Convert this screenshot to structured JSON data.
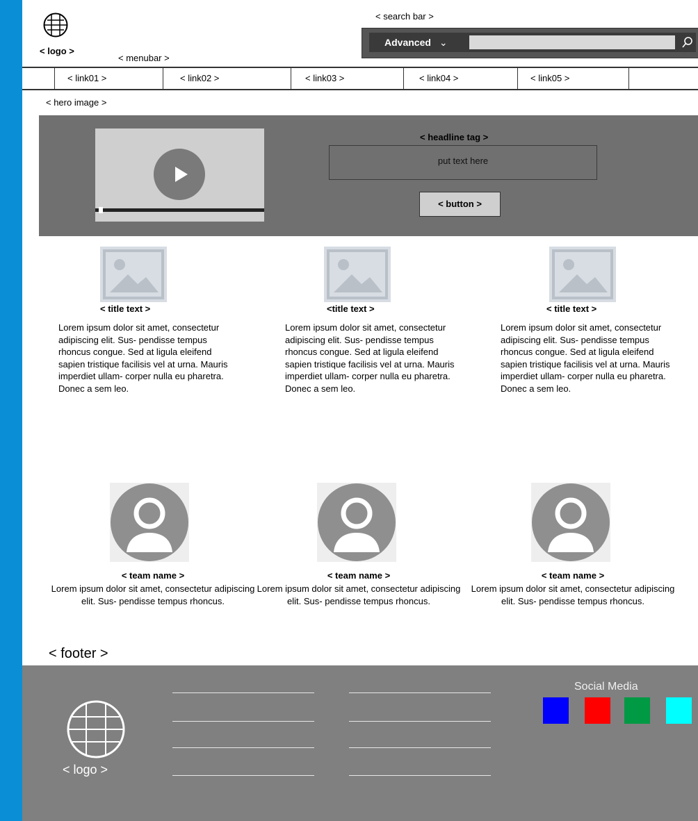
{
  "header": {
    "logo_label": "< logo >",
    "menubar_label": "< menubar >",
    "search_bar_label": "< search bar >",
    "search": {
      "filter_label": "Advanced",
      "placeholder": "",
      "filter_icon": "chevron-down-icon",
      "submit_icon": "search-icon"
    }
  },
  "nav": {
    "links": [
      "< link01 >",
      "< link02 >",
      "< link03 >",
      "< link04 >",
      "< link05 >"
    ]
  },
  "hero": {
    "label": "< hero image >",
    "video": {
      "play_icon": "play-icon",
      "progress_fraction": 0.02
    },
    "headline_tag": "< headline tag >",
    "headline_text": "put text here",
    "button_label": "< button >"
  },
  "features": [
    {
      "title": "< title text >",
      "body": "Lorem ipsum dolor sit amet, consectetur adipiscing elit. Sus- pendisse tempus rhoncus congue. Sed at ligula eleifend sapien tristique facilisis vel at urna. Mauris imperdiet ullam- corper nulla eu pharetra. Donec a sem leo."
    },
    {
      "title": "<title text >",
      "body": "Lorem ipsum dolor sit amet, consectetur adipiscing elit. Sus- pendisse tempus rhoncus congue. Sed at ligula eleifend sapien tristique facilisis vel at urna. Mauris imperdiet ullam- corper nulla eu pharetra. Donec a sem leo."
    },
    {
      "title": "< title text >",
      "body": "Lorem ipsum dolor sit amet, consectetur adipiscing elit. Sus- pendisse tempus rhoncus congue. Sed at ligula eleifend sapien tristique facilisis vel at urna. Mauris imperdiet ullam- corper nulla eu pharetra. Donec a sem leo."
    }
  ],
  "team": [
    {
      "name": "< team name >",
      "body": "Lorem ipsum dolor sit amet, consectetur adipiscing elit. Sus- pendisse tempus rhoncus."
    },
    {
      "name": "< team name >",
      "body": "Lorem ipsum dolor sit amet, consectetur adipiscing elit. Sus- pendisse tempus rhoncus."
    },
    {
      "name": "< team name >",
      "body": "Lorem ipsum dolor sit amet, consectetur adipiscing elit. Sus- pendisse tempus rhoncus."
    }
  ],
  "footer": {
    "label": "< footer >",
    "logo_label": "< logo >",
    "social_label": "Social Media",
    "social_colors": [
      "#0000ff",
      "#ff0000",
      "#009944",
      "#00ffff"
    ]
  },
  "colors": {
    "frame": "#0a8fd6",
    "hero_bg": "#707070",
    "footer_bg": "#808080",
    "search_bar_bg": "#555555"
  }
}
